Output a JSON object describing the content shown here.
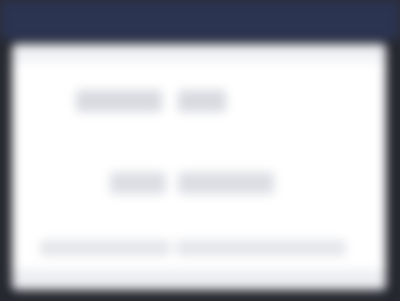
{
  "window": {
    "primary_text": "",
    "secondary_text": "",
    "tertiary_text": ""
  },
  "colors": {
    "title_bar": "#2b3450",
    "background": "#23252c",
    "window": "#ffffff"
  }
}
